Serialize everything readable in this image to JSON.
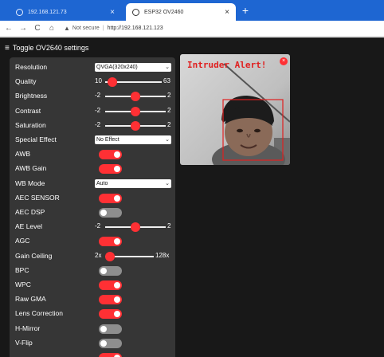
{
  "browser": {
    "tabs": [
      {
        "title": "192.168.121.73",
        "active": false
      },
      {
        "title": "ESP32 OV2460",
        "active": true
      }
    ],
    "new_tab_glyph": "+",
    "close_glyph": "×",
    "nav": {
      "back": "←",
      "forward": "→",
      "reload": "C",
      "home": "⌂"
    },
    "security_label": "Not secure",
    "url": "http://192.168.121.123"
  },
  "page": {
    "header_title": "Toggle OV2640 settings",
    "preview": {
      "alert_text": "Intruder Alert!",
      "close_glyph": "×",
      "detection_box_color": "#e02020"
    }
  },
  "settings": [
    {
      "label": "Resolution",
      "type": "select",
      "value": "QVGA(320x240)"
    },
    {
      "label": "Quality",
      "type": "slider",
      "min": "10",
      "max": "63",
      "position": 0.05
    },
    {
      "label": "Brightness",
      "type": "slider",
      "min": "-2",
      "max": "2",
      "position": 0.5
    },
    {
      "label": "Contrast",
      "type": "slider",
      "min": "-2",
      "max": "2",
      "position": 0.5
    },
    {
      "label": "Saturation",
      "type": "slider",
      "min": "-2",
      "max": "2",
      "position": 0.5
    },
    {
      "label": "Special Effect",
      "type": "select",
      "value": "No Effect"
    },
    {
      "label": "AWB",
      "type": "toggle",
      "on": true
    },
    {
      "label": "AWB Gain",
      "type": "toggle",
      "on": true
    },
    {
      "label": "WB Mode",
      "type": "select",
      "value": "Auto"
    },
    {
      "label": "AEC SENSOR",
      "type": "toggle",
      "on": true
    },
    {
      "label": "AEC DSP",
      "type": "toggle",
      "on": false
    },
    {
      "label": "AE Level",
      "type": "slider",
      "min": "-2",
      "max": "2",
      "position": 0.5
    },
    {
      "label": "AGC",
      "type": "toggle",
      "on": true
    },
    {
      "label": "Gain Ceiling",
      "type": "slider",
      "min": "2x",
      "max": "128x",
      "position": 0.0
    },
    {
      "label": "BPC",
      "type": "toggle",
      "on": false
    },
    {
      "label": "WPC",
      "type": "toggle",
      "on": true
    },
    {
      "label": "Raw GMA",
      "type": "toggle",
      "on": true
    },
    {
      "label": "Lens Correction",
      "type": "toggle",
      "on": true
    },
    {
      "label": "H-Mirror",
      "type": "toggle",
      "on": false
    },
    {
      "label": "V-Flip",
      "type": "toggle",
      "on": false
    },
    {
      "label": "",
      "type": "toggle",
      "on": true
    }
  ],
  "colors": {
    "accent": "#ff3034",
    "toggle_off": "#8e8e8e",
    "panel": "#363636",
    "page_bg": "#181818",
    "tabbar": "#1e66d2"
  }
}
